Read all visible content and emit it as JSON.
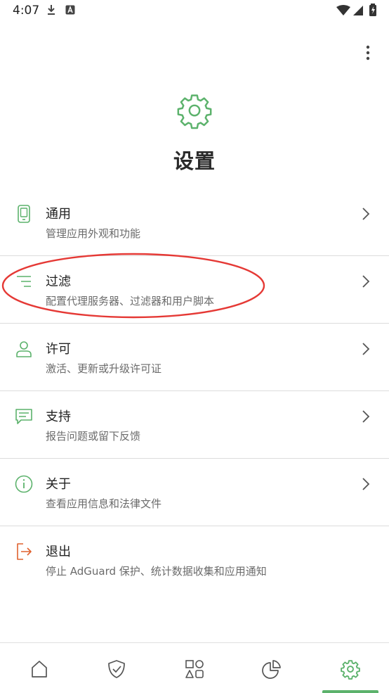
{
  "status_bar": {
    "time": "4:07"
  },
  "page": {
    "title": "设置"
  },
  "menu": [
    {
      "title": "通用",
      "subtitle": "管理应用外观和功能"
    },
    {
      "title": "过滤",
      "subtitle": "配置代理服务器、过滤器和用户脚本"
    },
    {
      "title": "许可",
      "subtitle": "激活、更新或升级许可证"
    },
    {
      "title": "支持",
      "subtitle": "报告问题或留下反馈"
    },
    {
      "title": "关于",
      "subtitle": "查看应用信息和法律文件"
    },
    {
      "title": "退出",
      "subtitle": "停止 AdGuard 保护、统计数据收集和应用通知"
    }
  ],
  "bottom_nav": {
    "items": [
      "home-icon",
      "shield-check-icon",
      "apps-grid-icon",
      "pie-chart-icon",
      "gear-icon"
    ],
    "selected": "gear-icon"
  },
  "colors": {
    "accent": "#5cb26c",
    "exit": "#e0622f",
    "annotation": "#e53935"
  }
}
